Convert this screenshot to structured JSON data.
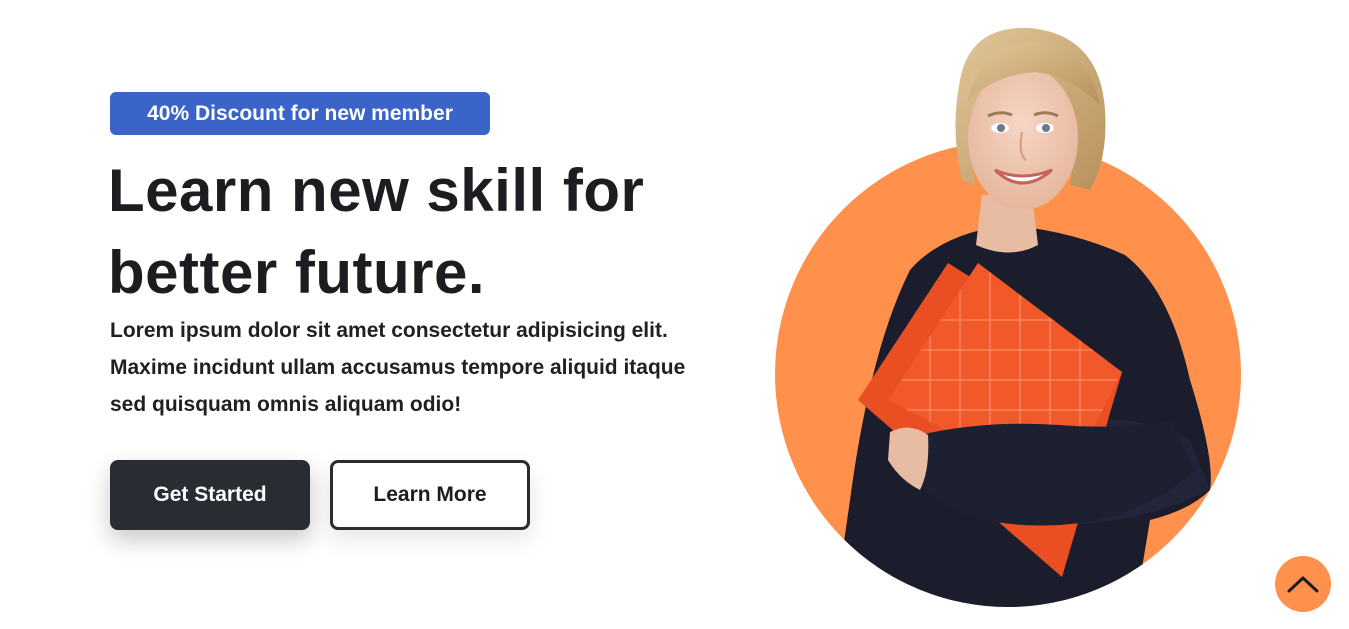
{
  "hero": {
    "badge": "40% Discount for new member",
    "title_line1": "Learn new skill for",
    "title_line2": "better future.",
    "description_line1": "Lorem ipsum dolor sit amet consectetur adipisicing elit.",
    "description_line2": "Maxime incidunt ullam accusamus tempore aliquid itaque",
    "description_line3": "sed quisquam omnis aliquam odio!",
    "primary_button": "Get Started",
    "secondary_button": "Learn More"
  },
  "icons": {
    "scroll_top": "chevron-up-icon",
    "hero_image": "woman-holding-notebook-illustration"
  },
  "colors": {
    "badge_bg": "#3a64c8",
    "primary_button_bg": "#2a2c33",
    "accent_orange": "#ff914d",
    "notebook_orange": "#f2592a",
    "text_dark": "#1c1d21"
  }
}
